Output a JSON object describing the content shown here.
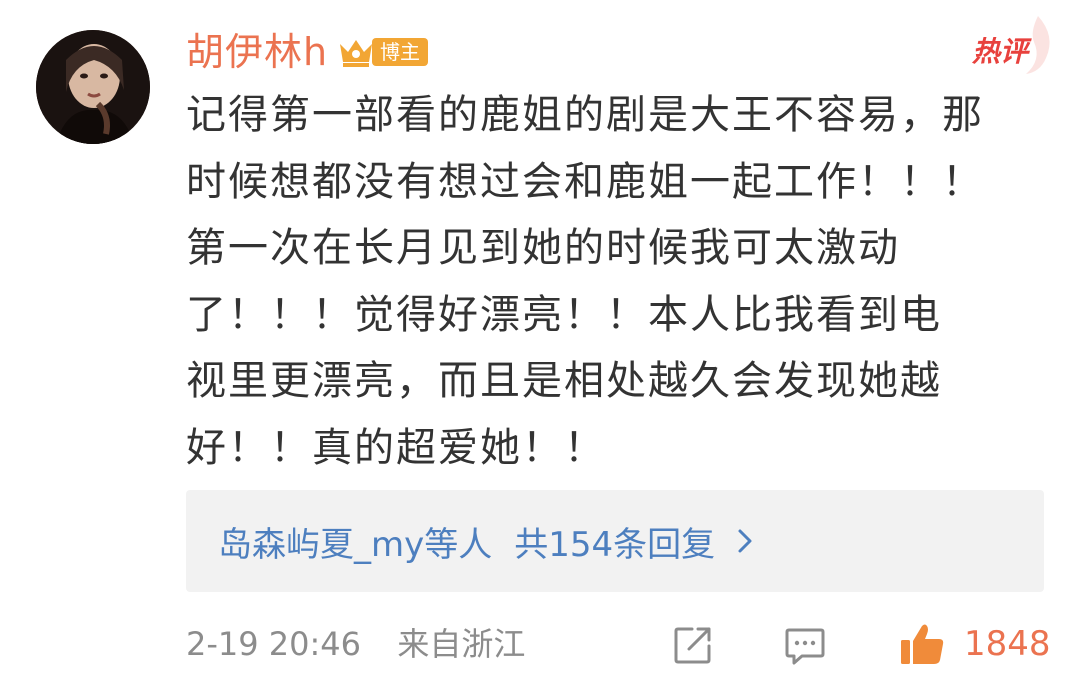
{
  "comment": {
    "username": "胡伊林h",
    "badge_label": "博主",
    "hot_tag": "热评",
    "text_lines": [
      "记得第一部看的鹿姐的剧是大王不容易，那",
      "时候想都没有想过会和鹿姐一起工作！！！",
      "第一次在长月见到她的时候我可太激动",
      "了！！！觉得好漂亮！！本人比我看到电",
      "视里更漂亮，而且是相处越久会发现她越",
      "好！！真的超爱她！！"
    ]
  },
  "replies": {
    "users_text": "岛森屿夏_my等人",
    "count_text": "共154条回复"
  },
  "footer": {
    "timestamp": "2-19 20:46",
    "source": "来自浙江",
    "like_count": "1848"
  },
  "colors": {
    "username": "#eb7350",
    "badge": "#f2a634",
    "hot_tag": "#e8413d",
    "reply_link": "#4d7fbf",
    "text": "#333333",
    "meta": "#8c8c8c"
  },
  "icons": {
    "share": "share-icon",
    "comment": "comment-icon",
    "like": "thumbs-up-icon",
    "chevron": "chevron-right-icon",
    "crown": "crown-icon"
  }
}
